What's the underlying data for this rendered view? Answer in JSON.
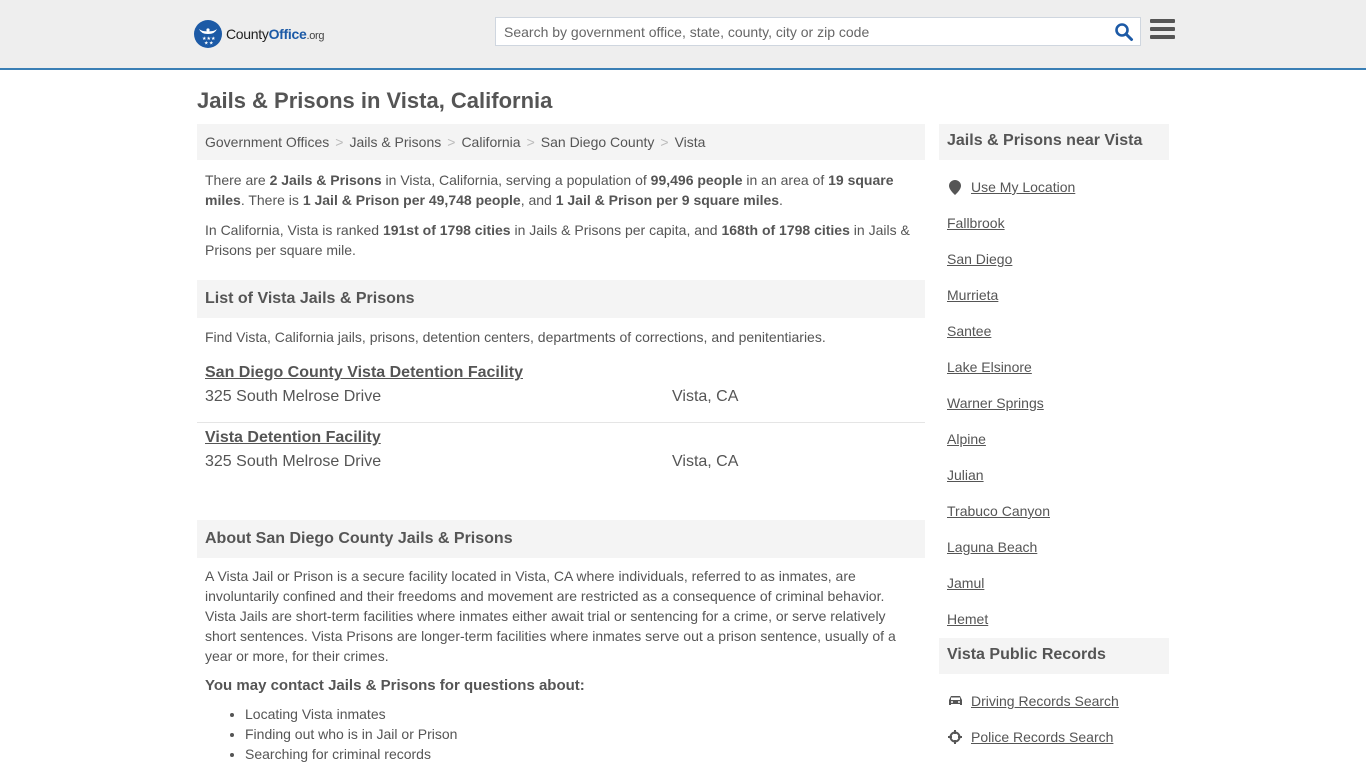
{
  "header": {
    "logo": {
      "county": "County",
      "office": "Office",
      "org": ".org"
    },
    "search": {
      "placeholder": "Search by government office, state, county, city or zip code",
      "value": ""
    }
  },
  "page": {
    "title": "Jails & Prisons in Vista, California"
  },
  "breadcrumb": [
    "Government Offices",
    "Jails & Prisons",
    "California",
    "San Diego County",
    "Vista"
  ],
  "breadcrumb_separator": ">",
  "summary": {
    "p1": [
      {
        "t": "There are ",
        "b": false
      },
      {
        "t": "2 Jails & Prisons",
        "b": true
      },
      {
        "t": " in Vista, California, serving a population of ",
        "b": false
      },
      {
        "t": "99,496 people",
        "b": true
      },
      {
        "t": " in an area of ",
        "b": false
      },
      {
        "t": "19 square miles",
        "b": true
      },
      {
        "t": ". There is ",
        "b": false
      },
      {
        "t": "1 Jail & Prison per 49,748 people",
        "b": true
      },
      {
        "t": ", and ",
        "b": false
      },
      {
        "t": "1 Jail & Prison per 9 square miles",
        "b": true
      },
      {
        "t": ".",
        "b": false
      }
    ],
    "p2": [
      {
        "t": "In California, Vista is ranked ",
        "b": false
      },
      {
        "t": "191st of 1798 cities",
        "b": true
      },
      {
        "t": " in Jails & Prisons per capita, and ",
        "b": false
      },
      {
        "t": "168th of 1798 cities",
        "b": true
      },
      {
        "t": " in Jails & Prisons per square mile.",
        "b": false
      }
    ]
  },
  "list": {
    "heading": "List of Vista Jails & Prisons",
    "intro": "Find Vista, California jails, prisons, detention centers, departments of corrections, and penitentiaries.",
    "items": [
      {
        "name": "San Diego County Vista Detention Facility",
        "address": "325 South Melrose Drive",
        "city": "Vista, CA"
      },
      {
        "name": "Vista Detention Facility",
        "address": "325 South Melrose Drive",
        "city": "Vista, CA"
      }
    ]
  },
  "about": {
    "heading": "About San Diego County Jails & Prisons",
    "body": "A Vista Jail or Prison is a secure facility located in Vista, CA where individuals, referred to as inmates, are involuntarily confined and their freedoms and movement are restricted as a consequence of criminal behavior. Vista Jails are short-term facilities where inmates either await trial or sentencing for a crime, or serve relatively short sentences. Vista Prisons are longer-term facilities where inmates serve out a prison sentence, usually of a year or more, for their crimes.",
    "contact_heading": "You may contact Jails & Prisons for questions about:",
    "bullets": [
      "Locating Vista inmates",
      "Finding out who is in Jail or Prison",
      "Searching for criminal records"
    ]
  },
  "sidebar": {
    "near_heading": "Jails & Prisons near Vista",
    "use_location": "Use My Location",
    "nearby": [
      "Fallbrook",
      "San Diego",
      "Murrieta",
      "Santee",
      "Lake Elsinore",
      "Warner Springs",
      "Alpine",
      "Julian",
      "Trabuco Canyon",
      "Laguna Beach",
      "Jamul",
      "Hemet"
    ],
    "records_heading": "Vista Public Records",
    "records": [
      {
        "label": "Driving Records Search",
        "icon": "car-icon"
      },
      {
        "label": "Police Records Search",
        "icon": "crosshair-icon"
      }
    ]
  },
  "colors": {
    "brand": "#1c5aa6",
    "accent_line": "#3a7fb5",
    "text": "#555555",
    "panel": "#f4f4f4"
  }
}
